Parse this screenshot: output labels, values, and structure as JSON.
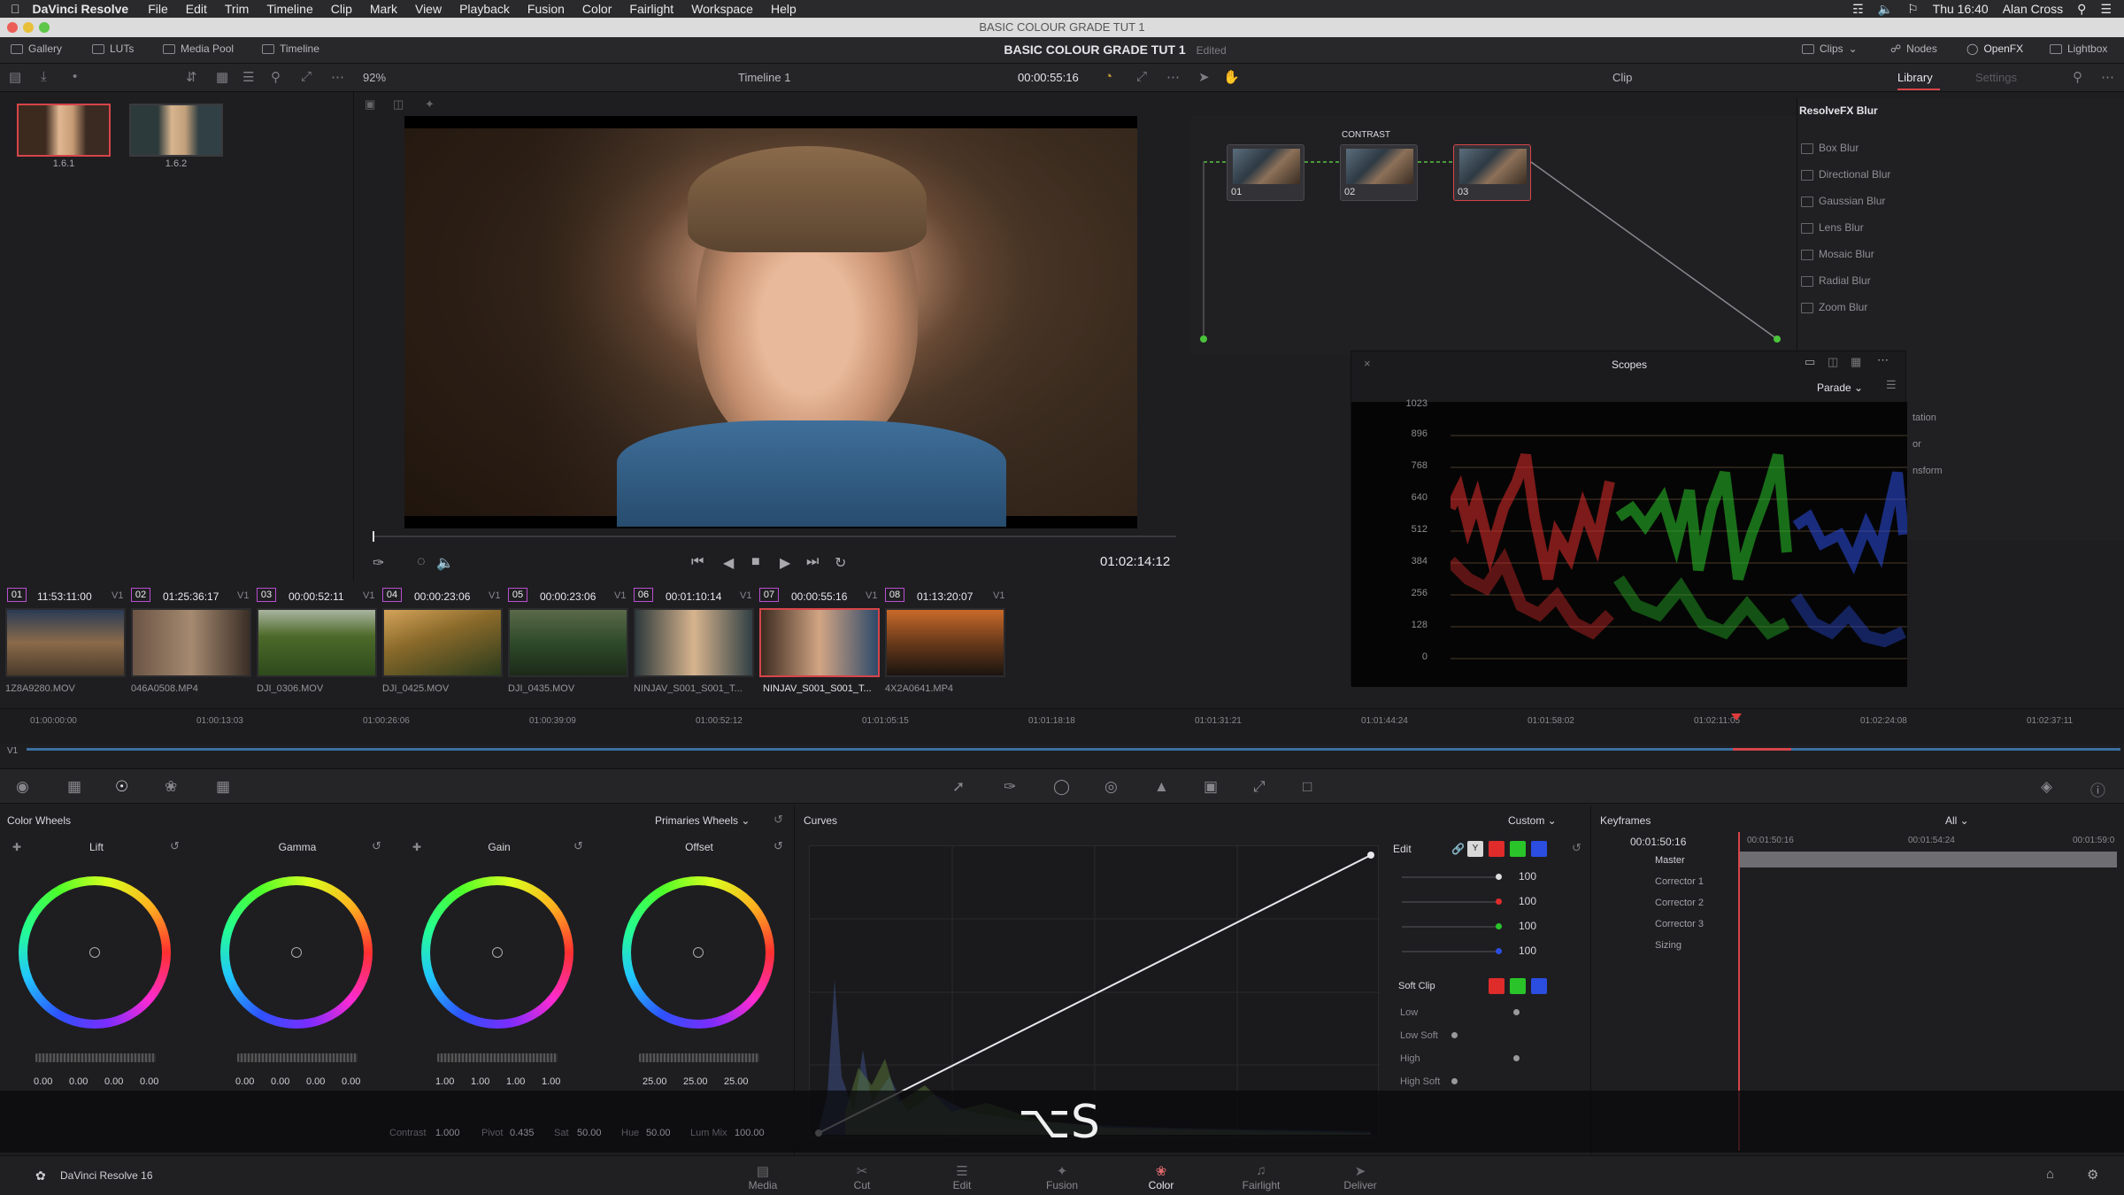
{
  "menubar": {
    "app": "DaVinci Resolve",
    "items": [
      "File",
      "Edit",
      "Trim",
      "Timeline",
      "Clip",
      "Mark",
      "View",
      "Playback",
      "Fusion",
      "Color",
      "Fairlight",
      "Workspace",
      "Help"
    ],
    "clock": "Thu 16:40",
    "user": "Alan Cross"
  },
  "window": {
    "title": "BASIC COLOUR GRADE TUT 1"
  },
  "header": {
    "gallery": "Gallery",
    "luts": "LUTs",
    "media_pool": "Media Pool",
    "timeline": "Timeline",
    "project": "BASIC COLOUR GRADE TUT 1",
    "status": "Edited",
    "clips": "Clips",
    "nodes": "Nodes",
    "openfx": "OpenFX",
    "lightbox": "Lightbox"
  },
  "toolbar": {
    "zoom": "92%",
    "timeline_name": "Timeline 1",
    "timecode": "00:00:55:16",
    "clip_mode": "Clip",
    "library_tab": "Library",
    "settings_tab": "Settings"
  },
  "gallery": {
    "stills": [
      {
        "label": "1.6.1",
        "selected": true
      },
      {
        "label": "1.6.2",
        "selected": false
      }
    ]
  },
  "viewer": {
    "timecode": "01:02:14:12"
  },
  "node_editor": {
    "nodes": [
      {
        "label": "01",
        "title": ""
      },
      {
        "label": "02",
        "title": "CONTRAST"
      },
      {
        "label": "03",
        "title": "",
        "selected": true
      }
    ]
  },
  "library": {
    "section": "ResolveFX Blur",
    "items": [
      "Box Blur",
      "Directional Blur",
      "Gaussian Blur",
      "Lens Blur",
      "Mosaic Blur",
      "Radial Blur",
      "Zoom Blur"
    ],
    "partial_items": [
      "tation",
      "or",
      "nsform"
    ]
  },
  "scopes": {
    "title": "Scopes",
    "mode": "Parade",
    "y_labels": [
      "1023",
      "896",
      "768",
      "640",
      "512",
      "384",
      "256",
      "128",
      "0"
    ]
  },
  "clips": [
    {
      "num": "01",
      "tc": "11:53:11:00",
      "track": "V1",
      "name": "1Z8A9280.MOV",
      "selected": false
    },
    {
      "num": "02",
      "tc": "01:25:36:17",
      "track": "V1",
      "name": "046A0508.MP4",
      "selected": false
    },
    {
      "num": "03",
      "tc": "00:00:52:11",
      "track": "V1",
      "name": "DJI_0306.MOV",
      "selected": false
    },
    {
      "num": "04",
      "tc": "00:00:23:06",
      "track": "V1",
      "name": "DJI_0425.MOV",
      "selected": false
    },
    {
      "num": "05",
      "tc": "00:00:23:06",
      "track": "V1",
      "name": "DJI_0435.MOV",
      "selected": false
    },
    {
      "num": "06",
      "tc": "00:01:10:14",
      "track": "V1",
      "name": "NINJAV_S001_S001_T...",
      "selected": false
    },
    {
      "num": "07",
      "tc": "00:00:55:16",
      "track": "V1",
      "name": "NINJAV_S001_S001_T...",
      "selected": true
    },
    {
      "num": "08",
      "tc": "01:13:20:07",
      "track": "V1",
      "name": "4X2A0641.MP4",
      "selected": false
    }
  ],
  "timeline_ruler": {
    "track": "V1",
    "ticks": [
      "01:00:00:00",
      "01:00:13:03",
      "01:00:26:06",
      "01:00:39:09",
      "01:00:52:12",
      "01:01:05:15",
      "01:01:18:18",
      "01:01:31:21",
      "01:01:44:24",
      "01:01:58:02",
      "01:02:11:05",
      "01:02:24:08",
      "01:02:37:11"
    ]
  },
  "color_wheels": {
    "title": "Color Wheels",
    "mode": "Primaries Wheels",
    "wheels": [
      {
        "name": "Lift",
        "values": [
          "0.00",
          "0.00",
          "0.00",
          "0.00"
        ]
      },
      {
        "name": "Gamma",
        "values": [
          "0.00",
          "0.00",
          "0.00",
          "0.00"
        ]
      },
      {
        "name": "Gain",
        "values": [
          "1.00",
          "1.00",
          "1.00",
          "1.00"
        ]
      },
      {
        "name": "Offset",
        "values": [
          "25.00",
          "25.00",
          "25.00"
        ]
      }
    ],
    "bottom": {
      "contrast_label": "Contrast",
      "contrast": "1.000",
      "pivot_label": "Pivot",
      "pivot": "0.435",
      "sat_label": "Sat",
      "sat": "50.00",
      "hue_label": "Hue",
      "hue": "50.00",
      "lummix_label": "Lum Mix",
      "lummix": "100.00"
    }
  },
  "curves": {
    "title": "Curves",
    "mode": "Custom",
    "edit_label": "Edit",
    "y_btn": "Y",
    "edit_values": [
      "100",
      "100",
      "100",
      "100"
    ],
    "soft_clip": "Soft Clip",
    "soft_rows": [
      "Low",
      "Low Soft",
      "High",
      "High Soft"
    ]
  },
  "keyframes": {
    "title": "Keyframes",
    "filter": "All",
    "timecode": "00:01:50:16",
    "ruler": [
      "00:01:50:16",
      "00:01:54:24",
      "00:01:59:0"
    ],
    "rows": [
      "Master",
      "Corrector 1",
      "Corrector 2",
      "Corrector 3",
      "Sizing"
    ]
  },
  "watermark": {
    "text": "⌥S"
  },
  "footer": {
    "app_name": "DaVinci Resolve 16",
    "pages": [
      "Media",
      "Cut",
      "Edit",
      "Fusion",
      "Color",
      "Fairlight",
      "Deliver"
    ],
    "active_page": "Color"
  },
  "colors": {
    "accent": "#d6454a",
    "red": "#e02b2b",
    "green": "#2ac42a",
    "blue": "#2b4de0"
  }
}
